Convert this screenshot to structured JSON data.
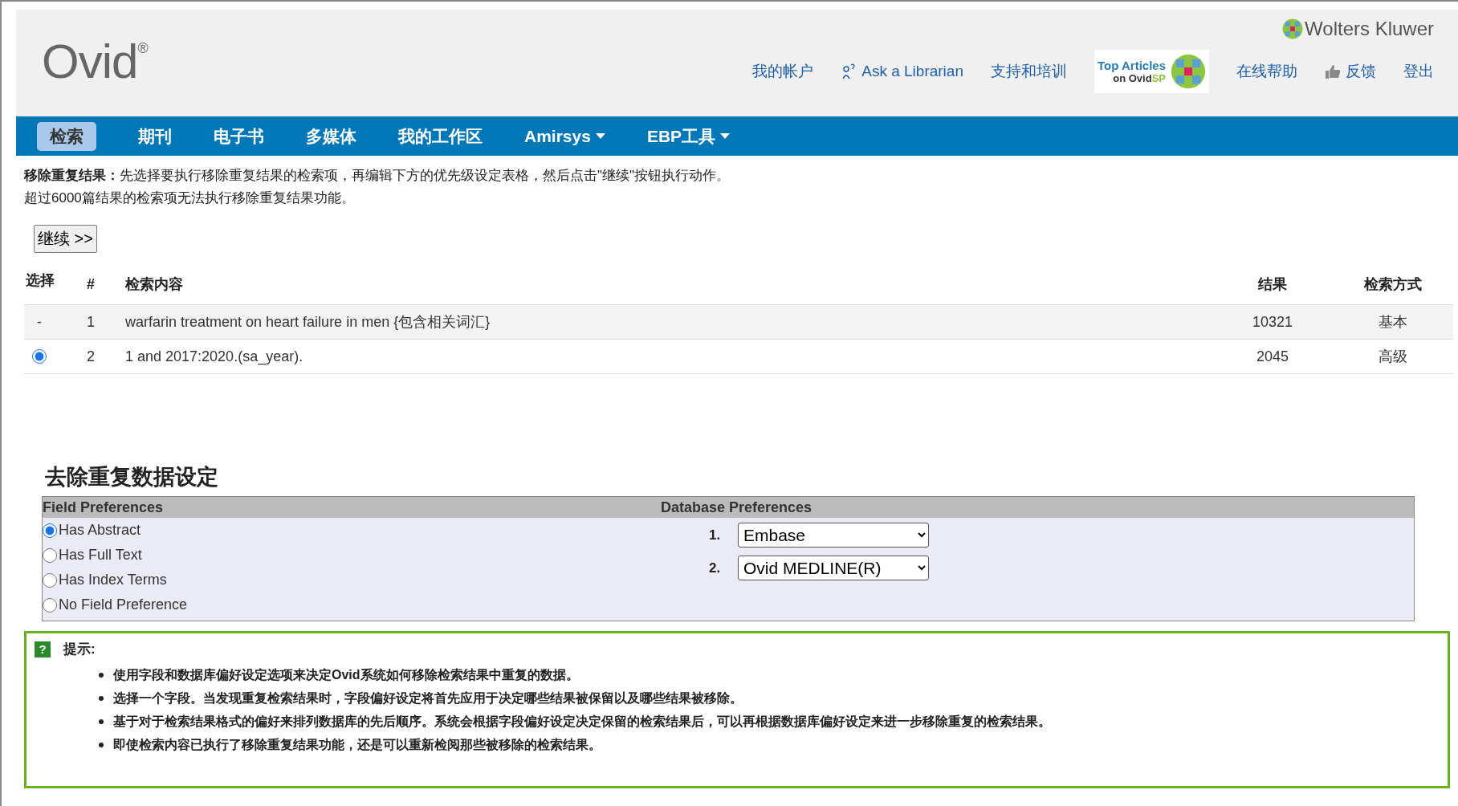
{
  "brand": {
    "logo": "Ovid",
    "registered": "®",
    "company": "Wolters Kluwer"
  },
  "top_links": [
    {
      "kind": "link",
      "label": "我的帐户"
    },
    {
      "kind": "librarian",
      "label": "Ask a Librarian"
    },
    {
      "kind": "link",
      "label": "支持和培训"
    },
    {
      "kind": "banner",
      "label": "Top Articles",
      "sublabel": "on Ovid",
      "sublabel_accent": "SP"
    },
    {
      "kind": "link",
      "label": "在线帮助"
    },
    {
      "kind": "feedback",
      "label": "反馈"
    },
    {
      "kind": "link",
      "label": "登出"
    }
  ],
  "nav": [
    {
      "label": "检索",
      "selected": true,
      "dropdown": false
    },
    {
      "label": "期刊",
      "selected": false,
      "dropdown": false
    },
    {
      "label": "电子书",
      "selected": false,
      "dropdown": false
    },
    {
      "label": "多媒体",
      "selected": false,
      "dropdown": false
    },
    {
      "label": "我的工作区",
      "selected": false,
      "dropdown": false
    },
    {
      "label": "Amirsys",
      "selected": false,
      "dropdown": true
    },
    {
      "label": "EBP工具",
      "selected": false,
      "dropdown": true
    }
  ],
  "intro": [
    "**移除重复结果：**先选择要执行移除重复结果的检索项，再编辑下方的优先级设定表格，然后点击\"继续\"按钮执行动作。",
    "超过6000篇结果的检索项无法执行移除重复结果功能。"
  ],
  "continue_button": "继续 >>",
  "table": {
    "columns": [
      "选择",
      "#",
      "检索内容",
      "结果",
      "检索方式"
    ],
    "rows": [
      {
        "kind": "dash",
        "select": "-",
        "number": "1",
        "query": "warfarin treatment on heart failure in men {包含相关词汇}",
        "results": "10321",
        "mode": "基本",
        "selected": false
      },
      {
        "kind": "radio",
        "number": "2",
        "query": "1 and 2017:2020.(sa_year).",
        "results": "2045",
        "mode": "高级",
        "selected": true
      }
    ]
  },
  "dedup": {
    "title": "去除重复数据设定",
    "field_header": "Field Preferences",
    "database_header": "Database Preferences",
    "fields": [
      {
        "label": "Has Abstract",
        "selected": true
      },
      {
        "label": "Has Full Text",
        "selected": false
      },
      {
        "label": "Has Index Terms",
        "selected": false
      },
      {
        "label": "No Field Preference",
        "selected": false
      }
    ],
    "databases": [
      {
        "rank": "1.",
        "value": "Embase"
      },
      {
        "rank": "2.",
        "value": "Ovid MEDLINE(R)"
      }
    ]
  },
  "tips": {
    "icon": "?",
    "title": "提示:",
    "items": [
      "使用字段和数据库偏好设定选项来决定Ovid系统如何移除检索结果中重复的数据。",
      "选择一个字段。当发现重复检索结果时，字段偏好设定将首先应用于决定哪些结果被保留以及哪些结果被移除。",
      "基于对于检索结果格式的偏好来排列数据库的先后顺序。系统会根据字段偏好设定决定保留的检索结果后，可以再根据数据库偏好设定来进一步移除重复的检索结果。",
      "即使检索内容已执行了移除重复结果功能，还是可以重新检阅那些被移除的检索结果。"
    ]
  }
}
